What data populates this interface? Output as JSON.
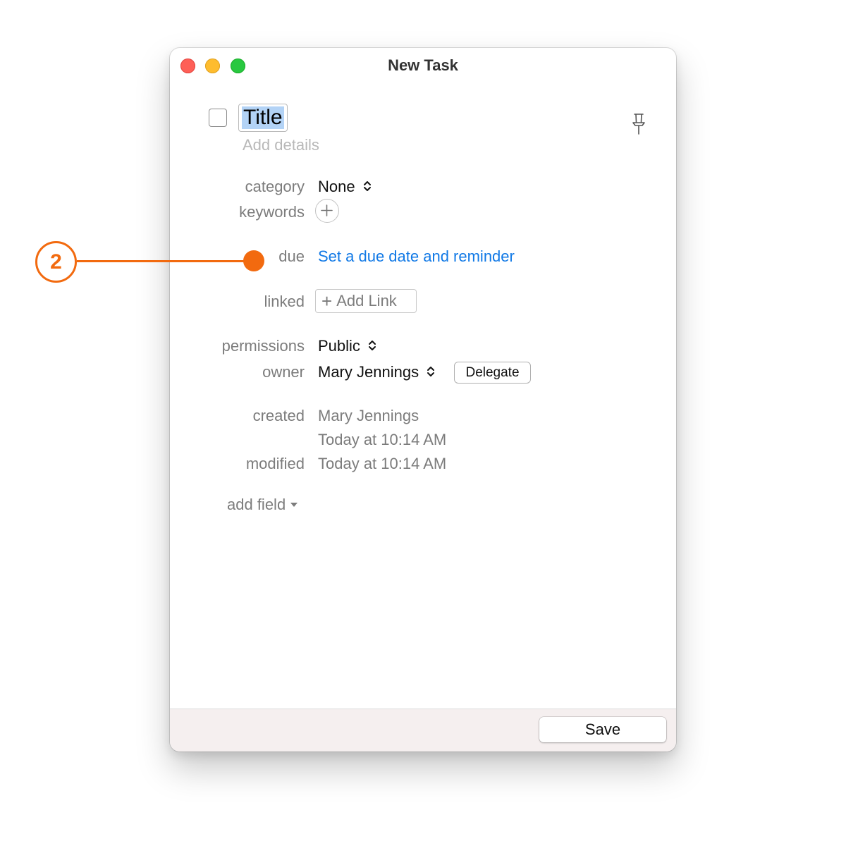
{
  "window": {
    "title": "New Task"
  },
  "task": {
    "title": "Title",
    "details_placeholder": "Add details"
  },
  "fields": {
    "category": {
      "label": "category",
      "value": "None"
    },
    "keywords": {
      "label": "keywords"
    },
    "due": {
      "label": "due",
      "value": "Set a due date and reminder"
    },
    "linked": {
      "label": "linked",
      "button": "Add Link"
    },
    "permissions": {
      "label": "permissions",
      "value": "Public"
    },
    "owner": {
      "label": "owner",
      "value": "Mary Jennings",
      "button": "Delegate"
    },
    "created": {
      "label": "created",
      "by": "Mary Jennings",
      "when": "Today at 10:14 AM"
    },
    "modified": {
      "label": "modified",
      "when": "Today at 10:14 AM"
    }
  },
  "add_field": {
    "label": "add field"
  },
  "footer": {
    "save": "Save"
  },
  "callout": {
    "number": "2",
    "color": "#f26a0f"
  },
  "colors": {
    "link": "#1179e6",
    "selection": "#b3d3f6",
    "footer": "#f5efef"
  },
  "icons": [
    "close-traffic-light",
    "minimize-traffic-light",
    "zoom-traffic-light",
    "pin-icon",
    "plus-icon",
    "chevron-updown-icon",
    "caret-down-icon"
  ]
}
